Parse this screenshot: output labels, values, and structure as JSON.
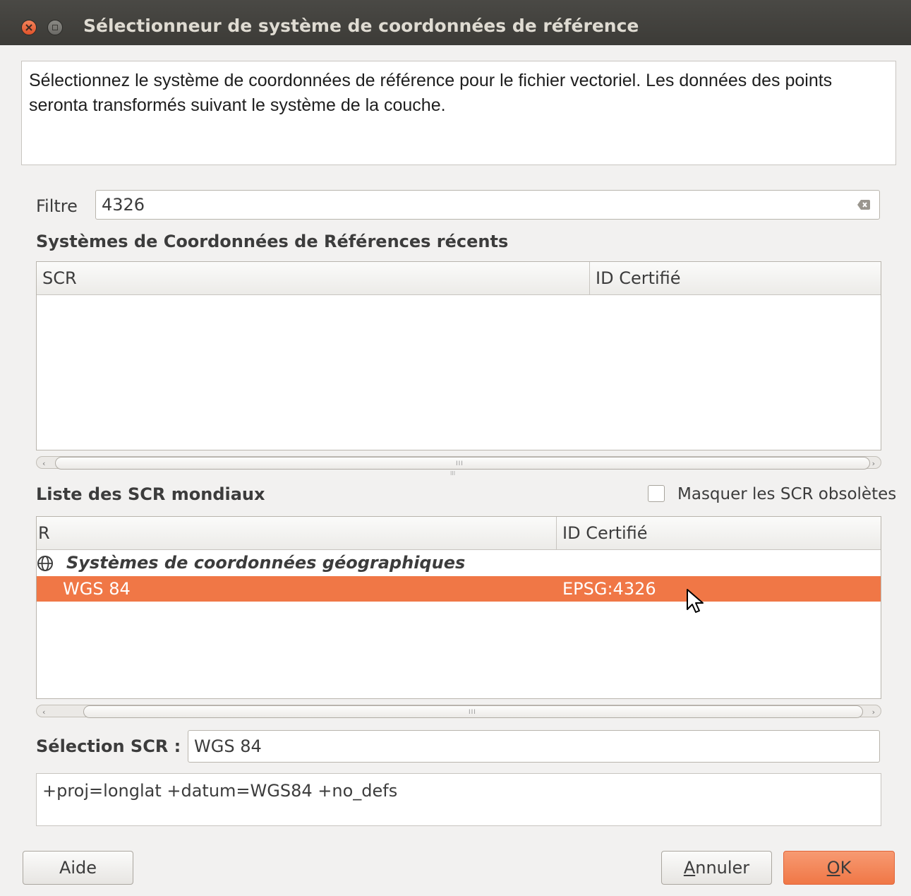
{
  "window": {
    "title": "Sélectionneur de système de coordonnées de référence"
  },
  "description": "Sélectionnez le système de coordonnées de référence pour le fichier vectoriel. Les données des points seronta transformés suivant le système de la couche.",
  "filter": {
    "label": "Filtre",
    "value": "4326"
  },
  "recent": {
    "title": "Systèmes de Coordonnées de Références récents",
    "columns": [
      "SCR",
      "ID Certifié"
    ],
    "rows": []
  },
  "world": {
    "title": "Liste des SCR mondiaux",
    "hide_obsolete_label": "Masquer les SCR obsolètes",
    "hide_obsolete_checked": false,
    "columns": [
      "R",
      "ID Certifié"
    ],
    "group_label": "Systèmes de coordonnées géographiques",
    "selected_row": {
      "name": "WGS 84",
      "id": "EPSG:4326"
    }
  },
  "selection": {
    "label": "Sélection SCR :",
    "value": "WGS 84",
    "proj": "+proj=longlat +datum=WGS84 +no_defs"
  },
  "buttons": {
    "help": "Aide",
    "cancel": "Annuler",
    "ok": "OK"
  },
  "colors": {
    "accent": "#f07746",
    "titlebar": "#3c3b37"
  }
}
